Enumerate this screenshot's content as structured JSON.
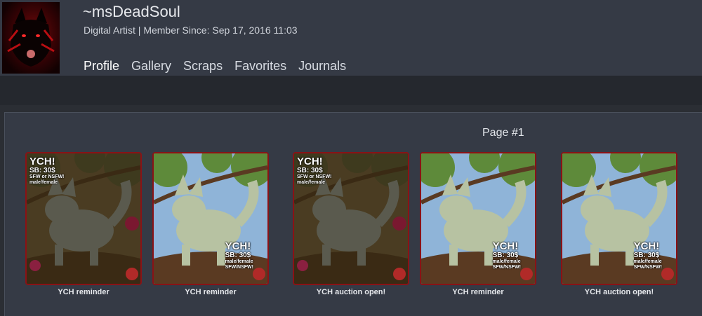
{
  "profile": {
    "username": "~msDeadSoul",
    "meta": "Digital Artist | Member Since: Sep 17, 2016 11:03"
  },
  "nav": {
    "items": [
      {
        "label": "Profile"
      },
      {
        "label": "Gallery"
      },
      {
        "label": "Scraps"
      },
      {
        "label": "Favorites"
      },
      {
        "label": "Journals"
      }
    ]
  },
  "gallery": {
    "page_label": "Page #1",
    "items": [
      {
        "caption": "YCH reminder",
        "style": "dark",
        "text_pos": "top-left",
        "badge_title": "YCH!",
        "badge_price": "SB: 30$",
        "badge_line1": "SFW or NSFW!",
        "badge_line2": "male/female"
      },
      {
        "caption": "YCH reminder",
        "style": "light",
        "text_pos": "bottom-right",
        "badge_title": "YCH!",
        "badge_price": "SB: 30$",
        "badge_line1": "male/female",
        "badge_line2": "SFW/NSFW!"
      },
      {
        "caption": "YCH auction open!",
        "style": "dark",
        "text_pos": "top-left",
        "badge_title": "YCH!",
        "badge_price": "SB: 30$",
        "badge_line1": "SFW or NSFW!",
        "badge_line2": "male/female"
      },
      {
        "caption": "YCH reminder",
        "style": "light",
        "text_pos": "bottom-right",
        "badge_title": "YCH!",
        "badge_price": "SB: 30$",
        "badge_line1": "male/female",
        "badge_line2": "SFW/NSFW!"
      },
      {
        "caption": "YCH auction open!",
        "style": "light",
        "text_pos": "bottom-right",
        "badge_title": "YCH!",
        "badge_price": "SB: 30$",
        "badge_line1": "male/female",
        "badge_line2": "SFW/NSFW!"
      }
    ]
  }
}
